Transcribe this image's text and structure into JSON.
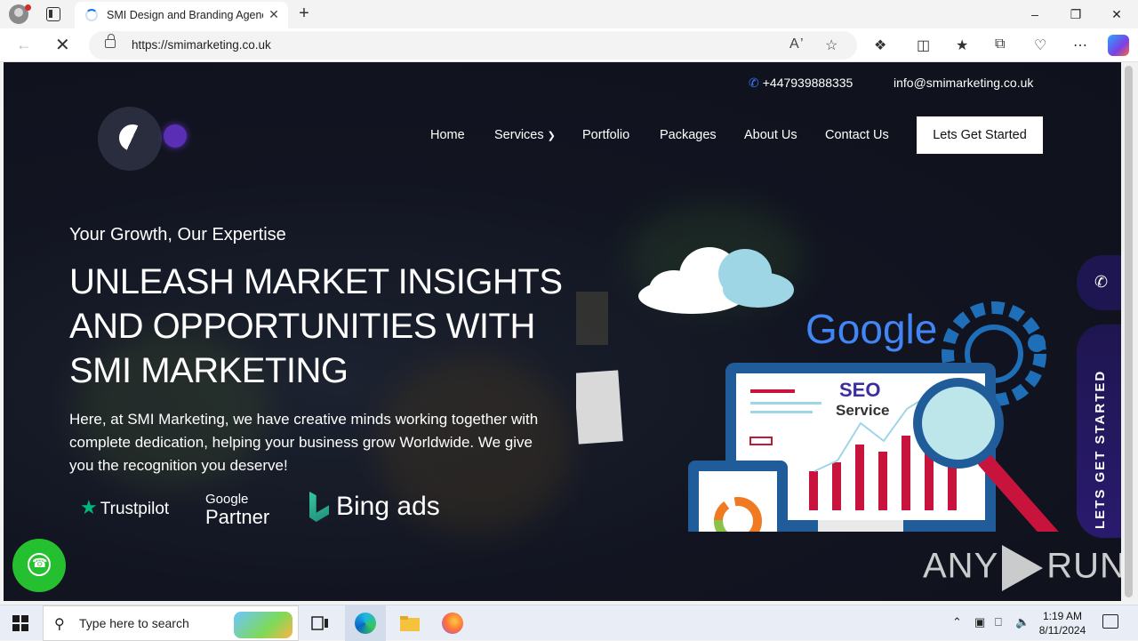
{
  "browser": {
    "tab_title": "SMI Design and Branding Agency",
    "url": "https://smimarketing.co.uk",
    "new_tab_glyph": "+",
    "close_glyph": "✕",
    "window_controls": {
      "minimize": "–",
      "restore": "❐",
      "close": "✕"
    },
    "icons": [
      "profile-icon",
      "tab-actions-icon",
      "loading-icon",
      "back-icon",
      "stop-icon",
      "lock-icon",
      "read-aloud-icon",
      "favorite-icon",
      "extensions-icon",
      "split-screen-icon",
      "favorites-icon",
      "collections-icon",
      "browser-essentials-icon",
      "more-icon",
      "copilot-icon"
    ]
  },
  "site": {
    "topbar": {
      "phone": "+447939888335",
      "email": "info@smimarketing.co.uk"
    },
    "nav": {
      "home": "Home",
      "services": "Services",
      "portfolio": "Portfolio",
      "packages": "Packages",
      "about": "About Us",
      "contact": "Contact Us",
      "cta": "Lets Get Started"
    },
    "hero": {
      "eyebrow": "Your Growth, Our Expertise",
      "headline_lines": [
        "UNLEASH MARKET INSIGHTS",
        "AND OPPORTUNITIES WITH",
        "SMI MARKETING"
      ],
      "lead": "Here, at SMI Marketing, we have creative minds working together with complete dedication, helping your business grow Worldwide. We give you the recognition you deserve!"
    },
    "badges": {
      "trustpilot": "Trustpilot",
      "google_top": "Google",
      "google_bottom": "Partner",
      "bing": "Bing ads"
    },
    "illustration": {
      "google": "Google",
      "seo_1": "SEO",
      "seo_2": "Service"
    },
    "side_tab": "LETS GET STARTED",
    "watermark_left": "ANY",
    "watermark_right": "RUN",
    "colors": {
      "background": "#121521",
      "cta_bg": "#ffffff",
      "side_tab": "#1e1650",
      "whatsapp": "#25c02f",
      "accent_red": "#c8143c",
      "phone_icon": "#3d7bff"
    }
  },
  "taskbar": {
    "search_placeholder": "Type here to search",
    "time": "1:19 AM",
    "date": "8/11/2024",
    "icons": [
      "windows-start-icon",
      "search-icon",
      "widgets-icon",
      "task-view-icon",
      "edge-icon",
      "file-explorer-icon",
      "firefox-icon",
      "chevron-up-icon",
      "meet-now-icon",
      "network-icon",
      "volume-icon",
      "notifications-icon"
    ]
  }
}
